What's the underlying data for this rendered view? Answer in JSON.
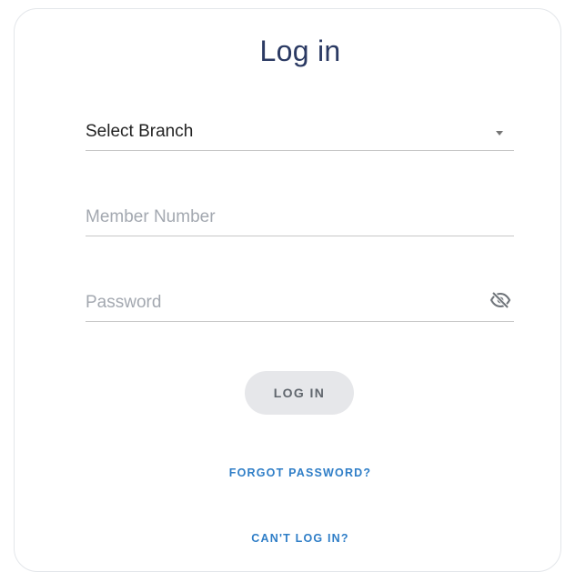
{
  "login": {
    "title": "Log in",
    "branch_select": {
      "selected": "Select Branch",
      "icon": "caret-down-icon"
    },
    "member_number": {
      "placeholder": "Member Number",
      "value": ""
    },
    "password": {
      "placeholder": "Password",
      "value": "",
      "toggle_icon": "eye-off-icon"
    },
    "submit_label": "LOG IN",
    "forgot_password_label": "FORGOT PASSWORD?",
    "cant_log_in_label": "CAN'T LOG IN?"
  },
  "colors": {
    "title": "#2b3a63",
    "link": "#2f7ec7",
    "button_bg": "#e6e7ea",
    "button_text": "#60666d",
    "placeholder": "#a3a8b0",
    "underline": "#c7c7c7"
  }
}
